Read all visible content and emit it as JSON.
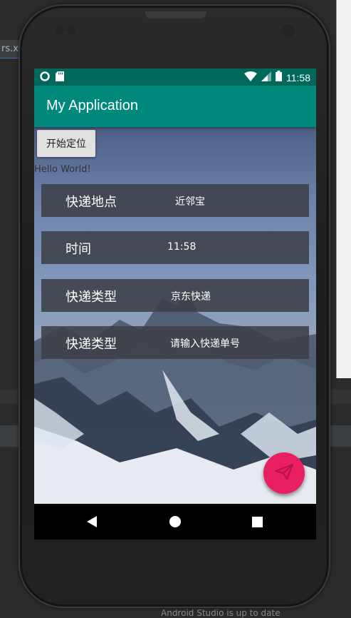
{
  "ide": {
    "tab_label": "rs.xr",
    "bottom_text": "Android Studio is up to date"
  },
  "status_bar": {
    "time": "11:58",
    "icons": [
      "circle-icon",
      "sd-card-icon",
      "wifi-icon",
      "signal-icon",
      "battery-icon"
    ]
  },
  "app_bar": {
    "title": "My Application"
  },
  "main": {
    "locate_button": "开始定位",
    "hello_text": "Hello World!",
    "rows": [
      {
        "label": "快递地点",
        "value": "近邻宝"
      },
      {
        "label": "时间",
        "value": "11:58"
      },
      {
        "label": "快递类型",
        "value": "京东快递"
      },
      {
        "label": "快递类型",
        "value": "请输入快递单号"
      }
    ]
  },
  "fab": {
    "icon": "send-icon"
  },
  "nav_bar": {
    "icons": [
      "back-icon",
      "home-icon",
      "recent-apps-icon"
    ]
  },
  "colors": {
    "status_bar": "#00695c",
    "app_bar": "#00897b",
    "fab": "#e91e63"
  }
}
